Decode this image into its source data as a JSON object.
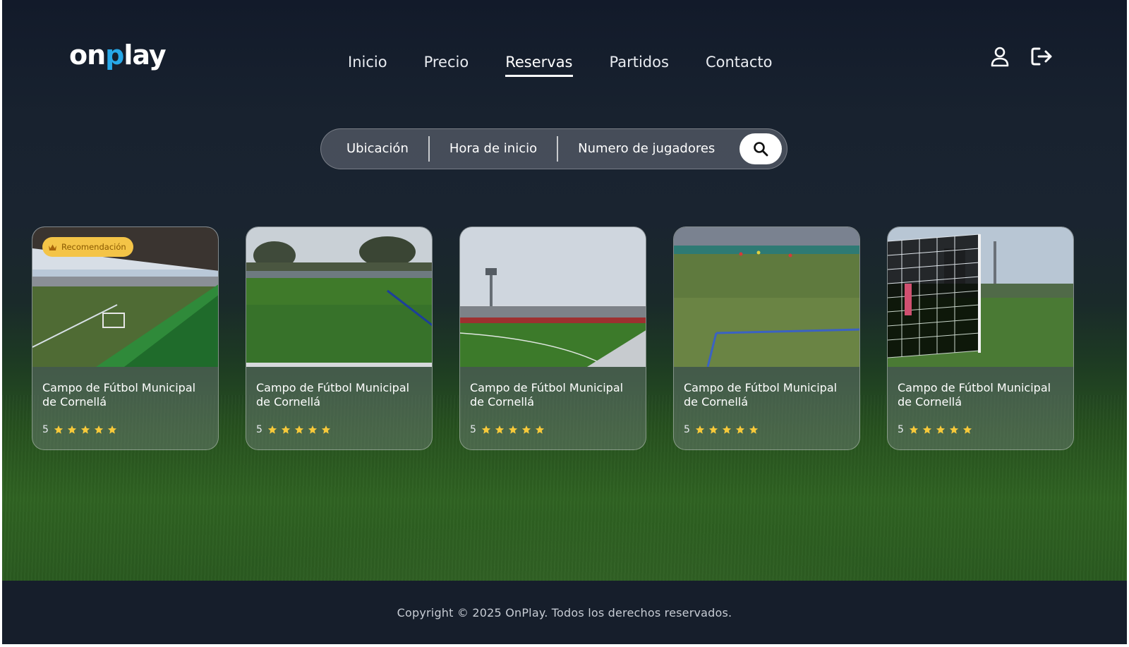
{
  "header": {
    "logo_prefix": "on",
    "logo_accent": "p",
    "logo_suffix": "lay",
    "nav": [
      {
        "label": "Inicio",
        "active": false
      },
      {
        "label": "Precio",
        "active": false
      },
      {
        "label": "Reservas",
        "active": true
      },
      {
        "label": "Partidos",
        "active": false
      },
      {
        "label": "Contacto",
        "active": false
      }
    ],
    "icons": {
      "profile": "user-icon",
      "logout": "logout-icon"
    }
  },
  "search": {
    "location": "Ubicación",
    "start_time": "Hora de inicio",
    "players": "Numero de jugadores",
    "button_icon": "search-icon"
  },
  "cards": [
    {
      "title": "Campo de Fútbol Municipal de Cornellá",
      "rating": "5",
      "stars": 5,
      "badge": "Recomendación"
    },
    {
      "title": "Campo de Fútbol Municipal de Cornellá",
      "rating": "5",
      "stars": 5,
      "badge": ""
    },
    {
      "title": "Campo de Fútbol Municipal de Cornellá",
      "rating": "5",
      "stars": 5,
      "badge": ""
    },
    {
      "title": "Campo de Fútbol Municipal de Cornellá",
      "rating": "5",
      "stars": 5,
      "badge": ""
    },
    {
      "title": "Campo de Fútbol Municipal de Cornellá",
      "rating": "5",
      "stars": 5,
      "badge": ""
    }
  ],
  "footer": {
    "copyright": "Copyright © 2025 OnPlay. Todos los derechos reservados."
  },
  "colors": {
    "accent": "#27a8e8",
    "badge": "#f4c447",
    "star": "#f7c93a",
    "footer_bg": "#161e2b"
  }
}
